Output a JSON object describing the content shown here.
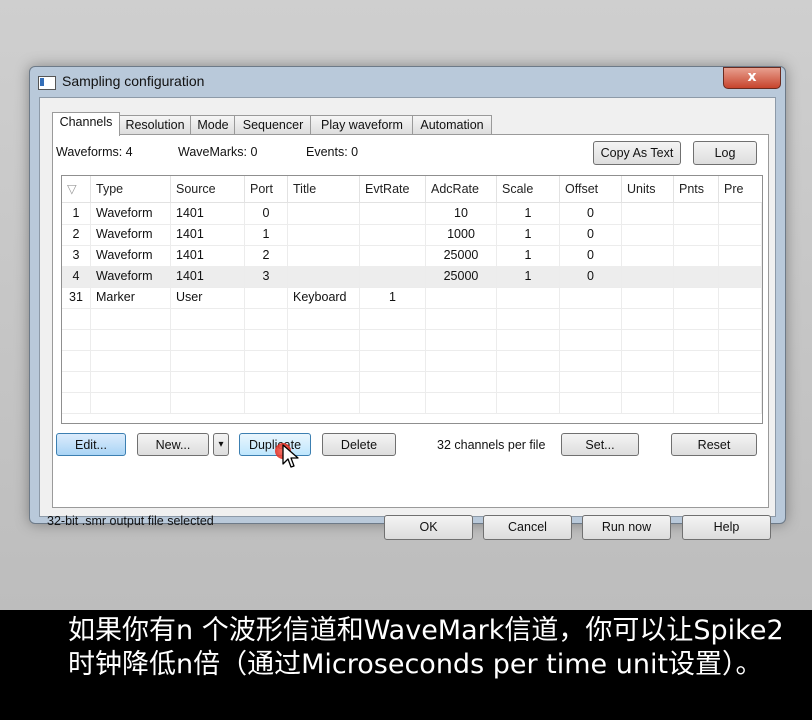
{
  "window": {
    "title": "Sampling configuration",
    "close_glyph": "x"
  },
  "tabs": [
    "Channels",
    "Resolution",
    "Mode",
    "Sequencer",
    "Play waveform",
    "Automation"
  ],
  "stats": {
    "waveforms": "Waveforms: 4",
    "wavemarks": "WaveMarks: 0",
    "events": "Events: 0"
  },
  "toolbar": {
    "copy_as_text": "Copy As Text",
    "log": "Log"
  },
  "table": {
    "sort_glyph": "▽",
    "columns": [
      "Type",
      "Source",
      "Port",
      "Title",
      "EvtRate",
      "AdcRate",
      "Scale",
      "Offset",
      "Units",
      "Pnts",
      "Pre"
    ],
    "rows": [
      {
        "num": "1",
        "type": "Waveform",
        "source": "1401",
        "port": "0",
        "title": "",
        "evtrate": "",
        "adcrate": "10",
        "scale": "1",
        "offset": "0"
      },
      {
        "num": "2",
        "type": "Waveform",
        "source": "1401",
        "port": "1",
        "title": "",
        "evtrate": "",
        "adcrate": "1000",
        "scale": "1",
        "offset": "0"
      },
      {
        "num": "3",
        "type": "Waveform",
        "source": "1401",
        "port": "2",
        "title": "",
        "evtrate": "",
        "adcrate": "25000",
        "scale": "1",
        "offset": "0"
      },
      {
        "num": "4",
        "type": "Waveform",
        "source": "1401",
        "port": "3",
        "title": "",
        "evtrate": "",
        "adcrate": "25000",
        "scale": "1",
        "offset": "0"
      },
      {
        "num": "31",
        "type": "Marker",
        "source": "User",
        "port": "",
        "title": "Keyboard",
        "evtrate": "1",
        "adcrate": "",
        "scale": "",
        "offset": ""
      }
    ]
  },
  "actions": {
    "edit": "Edit...",
    "new": "New...",
    "dropdown_glyph": "▾",
    "duplicate": "Duplicate",
    "delete": "Delete",
    "channels_per_file": "32 channels per file",
    "set": "Set...",
    "reset": "Reset"
  },
  "footer": {
    "status": "32-bit .smr output file selected",
    "ok": "OK",
    "cancel": "Cancel",
    "run_now": "Run now",
    "help": "Help"
  },
  "subtitle": "如果你有n 个波形信道和WaveMark信道，你可以让Spike2时钟降低n倍（通过Microseconds per time unit设置）。",
  "colors": {
    "accent": "#3c7fb1",
    "close": "#c7442d",
    "cursor_click": "#d8150c"
  }
}
